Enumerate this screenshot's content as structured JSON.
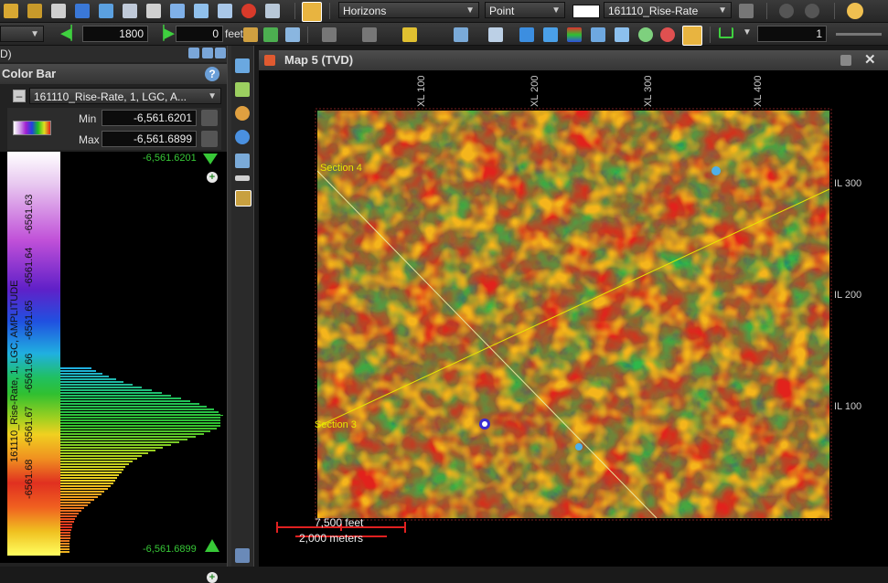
{
  "toolbar1": {
    "horizons_dropdown": "Horizons",
    "point_dropdown": "Point",
    "attribute_dropdown": "161110_Rise-Rate"
  },
  "toolbar2": {
    "frame_value": "1800",
    "offset_value": "0",
    "unit_label": "feet",
    "right_value": "1"
  },
  "left_panel": {
    "header_text": "D)",
    "colorbar_title": "Color Bar",
    "attribute_select": "161110_Rise-Rate, 1, LGC, A...",
    "min_label": "Min",
    "min_value": "-6,561.6201",
    "max_label": "Max",
    "max_value": "-6,561.6899",
    "top_value": "-6,561.6201",
    "bottom_value": "-6,561.6899",
    "axis_title": "161110_Rise-Rate, 1, LGC, AMPLITUDE",
    "ticks": [
      "-6561.63",
      "-6561.64",
      "-6561.65",
      "-6561.66",
      "-6561.67",
      "-6561.68"
    ]
  },
  "map": {
    "title": "Map 5 (TVD)",
    "xl_labels": [
      "XL 100",
      "XL 200",
      "XL 300",
      "XL 400"
    ],
    "il_labels": [
      "IL 300",
      "IL 200",
      "IL 100"
    ],
    "section_a": "Section 4",
    "section_b": "Section 3",
    "scale_feet": "7,500 feet",
    "scale_meters": "2,000 meters"
  },
  "colors": {
    "background": "#000000",
    "accent": "#37c837",
    "section_line": "#e8e800"
  }
}
